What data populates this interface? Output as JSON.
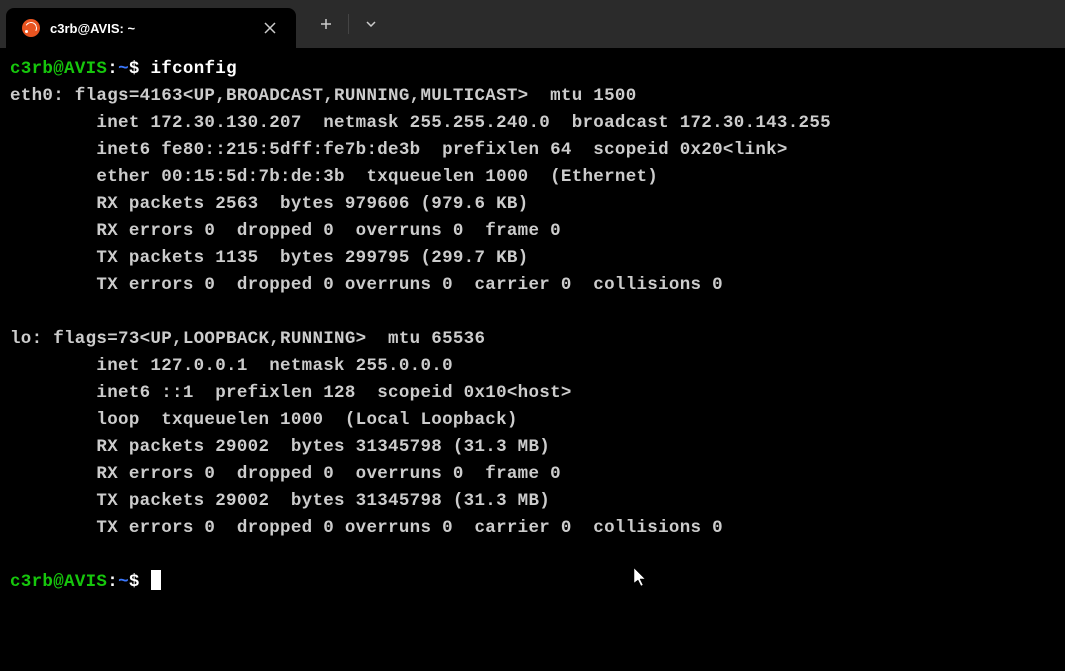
{
  "tab": {
    "title": "c3rb@AVIS: ~"
  },
  "prompt": {
    "user": "c3rb",
    "at": "@",
    "host": "AVIS",
    "colon": ":",
    "path": "~",
    "symbol": "$"
  },
  "commands": {
    "ifconfig": "ifconfig"
  },
  "output": {
    "eth0_header": "eth0: flags=4163<UP,BROADCAST,RUNNING,MULTICAST>  mtu 1500",
    "eth0_inet": "        inet 172.30.130.207  netmask 255.255.240.0  broadcast 172.30.143.255",
    "eth0_inet6": "        inet6 fe80::215:5dff:fe7b:de3b  prefixlen 64  scopeid 0x20<link>",
    "eth0_ether": "        ether 00:15:5d:7b:de:3b  txqueuelen 1000  (Ethernet)",
    "eth0_rx_packets": "        RX packets 2563  bytes 979606 (979.6 KB)",
    "eth0_rx_errors": "        RX errors 0  dropped 0  overruns 0  frame 0",
    "eth0_tx_packets": "        TX packets 1135  bytes 299795 (299.7 KB)",
    "eth0_tx_errors": "        TX errors 0  dropped 0 overruns 0  carrier 0  collisions 0",
    "blank": "",
    "lo_header": "lo: flags=73<UP,LOOPBACK,RUNNING>  mtu 65536",
    "lo_inet": "        inet 127.0.0.1  netmask 255.0.0.0",
    "lo_inet6": "        inet6 ::1  prefixlen 128  scopeid 0x10<host>",
    "lo_loop": "        loop  txqueuelen 1000  (Local Loopback)",
    "lo_rx_packets": "        RX packets 29002  bytes 31345798 (31.3 MB)",
    "lo_rx_errors": "        RX errors 0  dropped 0  overruns 0  frame 0",
    "lo_tx_packets": "        TX packets 29002  bytes 31345798 (31.3 MB)",
    "lo_tx_errors": "        TX errors 0  dropped 0 overruns 0  carrier 0  collisions 0"
  }
}
